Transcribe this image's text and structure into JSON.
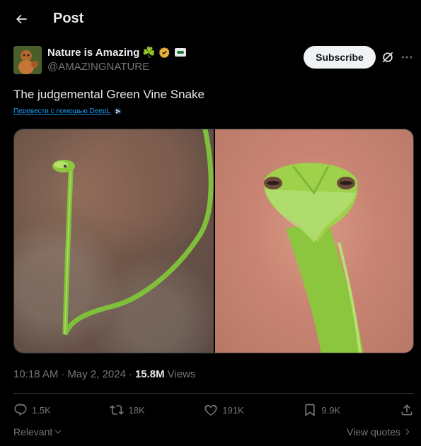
{
  "header": {
    "title": "Post"
  },
  "author": {
    "name": "Nature is Amazing",
    "name_emoji": "☘️",
    "handle": "@AMAZ!NGNATURE"
  },
  "subscribe_label": "Subscribe",
  "tweet": {
    "text": "The judgemental Green Vine Snake",
    "translate_label": "Перевести с помощью DeepL"
  },
  "meta": {
    "time": "10:18 AM",
    "dot1": "·",
    "date": "May 2, 2024",
    "dot2": "·",
    "views_count": "15.8M",
    "views_label": "Views"
  },
  "actions": {
    "replies": "1.5K",
    "reposts": "18K",
    "likes": "191K",
    "bookmarks": "9.9K"
  },
  "footer": {
    "relevant_label": "Relevant",
    "view_quotes_label": "View quotes"
  },
  "colors": {
    "background": "#000000",
    "text_primary": "#e7e9ea",
    "text_secondary": "#71767b",
    "link": "#1d9bf0",
    "verified_gold": "#e8b23a",
    "snake_green": "#8cc63f"
  }
}
